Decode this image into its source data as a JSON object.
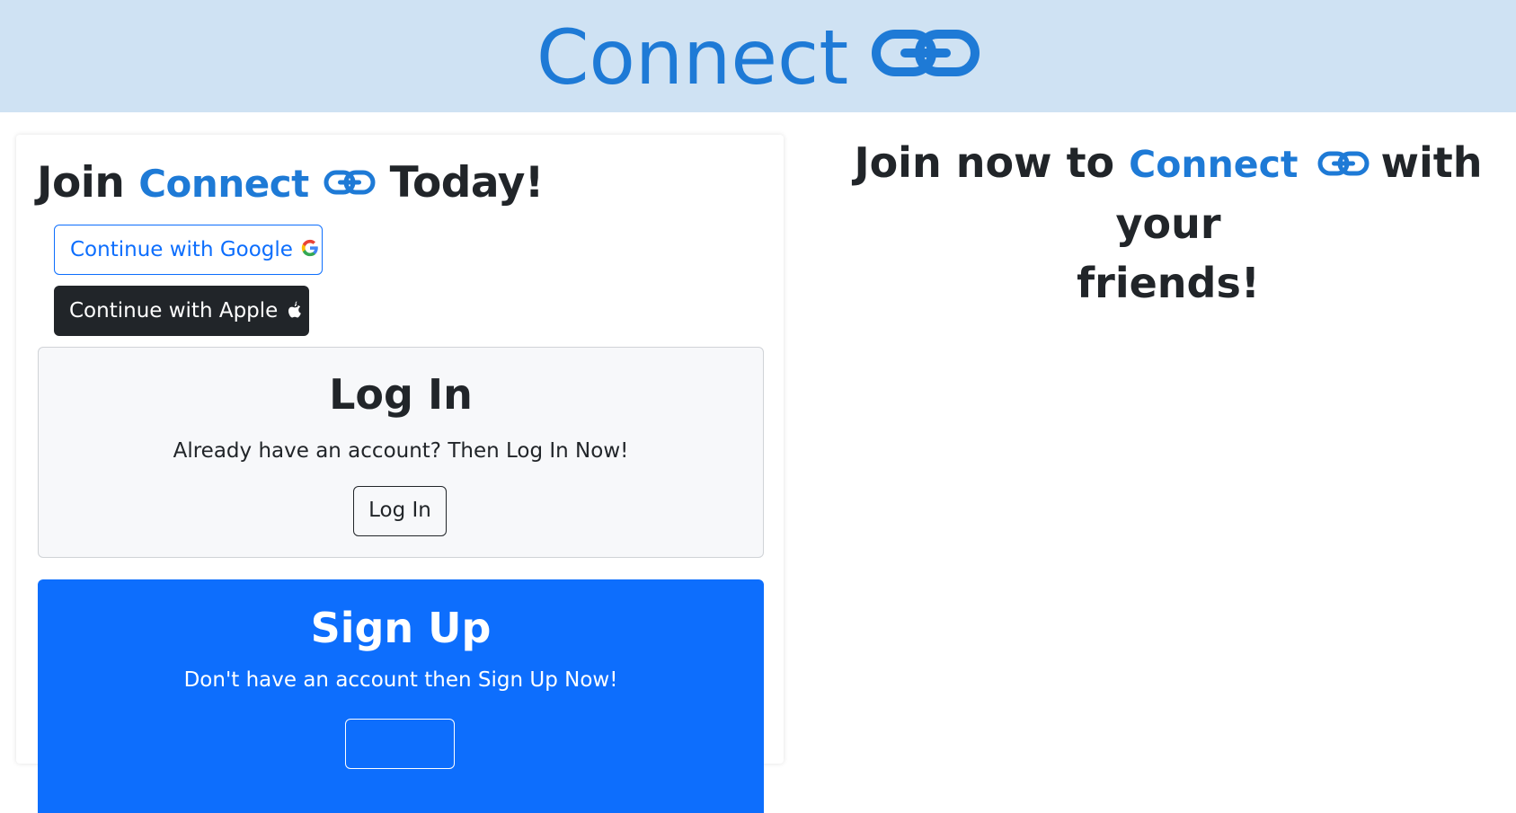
{
  "header": {
    "brand": "Connect"
  },
  "join_card": {
    "title_prefix": "Join",
    "title_brand": "Connect",
    "title_suffix": "Today!",
    "google_button": "Continue with Google",
    "apple_button": "Continue with Apple"
  },
  "login": {
    "title": "Log In",
    "subtitle": "Already have an account? Then Log In Now!",
    "button": "Log In"
  },
  "signup": {
    "title": "Sign Up",
    "subtitle": "Don't have an account then Sign Up Now!"
  },
  "right_panel": {
    "prefix": "Join now to",
    "brand": "Connect",
    "line1_suffix": "with your",
    "line2": "friends!"
  },
  "colors": {
    "brand": "#1e7ad6",
    "header_bg": "#cfe2f3",
    "primary": "#0d6efd",
    "dark": "#212529"
  },
  "icons": {
    "brand_icon": "link-icon",
    "google": "google-icon",
    "apple": "apple-icon"
  }
}
